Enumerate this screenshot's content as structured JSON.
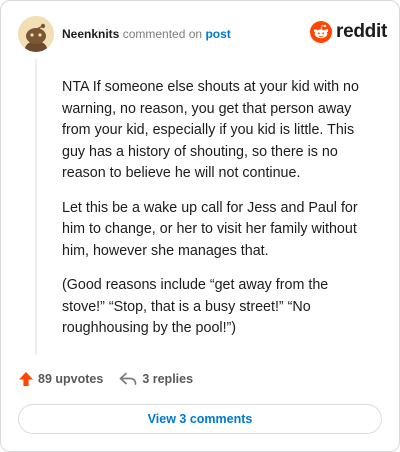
{
  "header": {
    "username": "Neenknits",
    "action_text": "commented on",
    "post_link": "post",
    "brand": "reddit"
  },
  "comment": {
    "paragraphs": [
      "NTA If someone else shouts at your kid with no warning, no reason, you get that person away from your kid, especially if you kid is little. This guy has a history of shouting, so there is no reason to believe he will not continue.",
      "Let this be a wake up call for Jess and Paul for him to change, or her to visit her family without him, however she manages that.",
      "(Good reasons include “get away from the stove!” “Stop, that is a busy street!” “No roughhousing by the pool!”)"
    ]
  },
  "footer": {
    "upvotes": "89 upvotes",
    "replies": "3 replies",
    "view_comments": "View 3 comments"
  },
  "icons": {
    "avatar": "snoo-avatar",
    "logo": "reddit-snoo-icon",
    "upvote": "upvote-arrow-icon",
    "reply": "reply-arrow-icon"
  },
  "colors": {
    "reddit_orange": "#ff4500",
    "link_blue": "#0079d3",
    "muted_text": "#7c7c7c"
  }
}
